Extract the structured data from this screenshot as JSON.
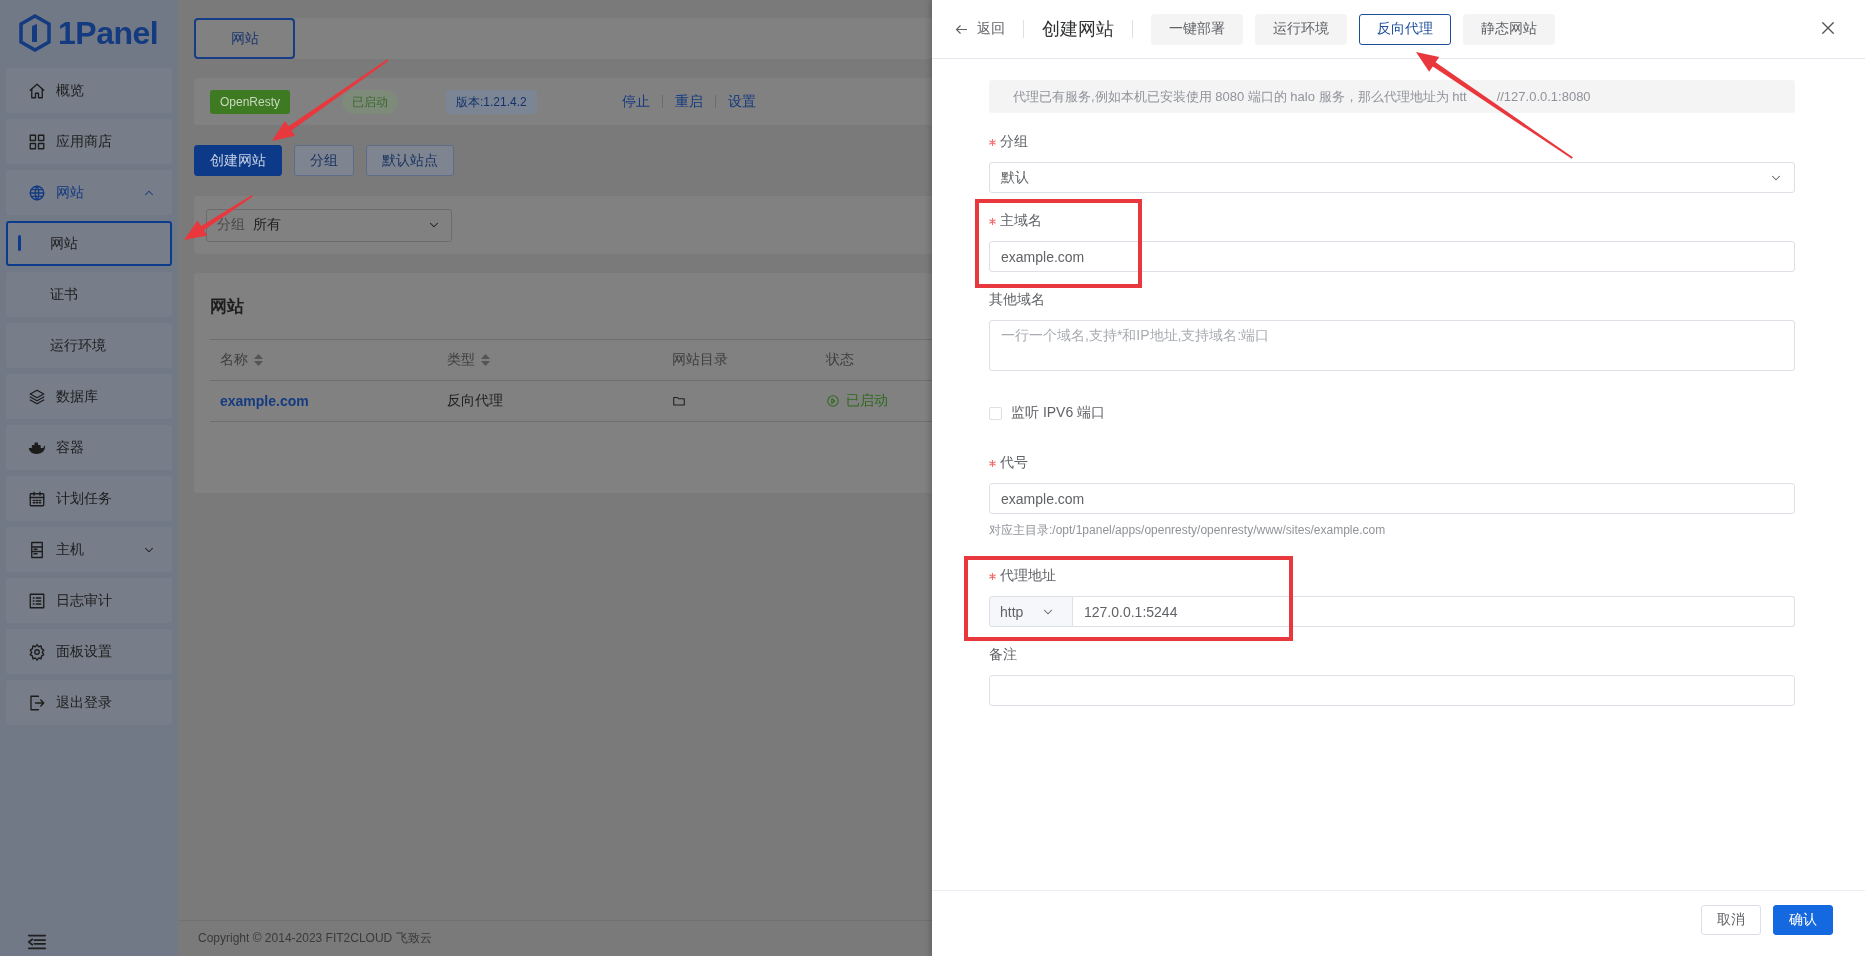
{
  "sidebar": {
    "logo": "1Panel",
    "items": [
      {
        "label": "概览",
        "kind": "link",
        "selected": false
      },
      {
        "label": "应用商店",
        "kind": "link",
        "selected": false
      },
      {
        "label": "网站",
        "kind": "group",
        "expanded": true,
        "selected": false,
        "children": [
          {
            "label": "网站",
            "selected": true
          },
          {
            "label": "证书",
            "selected": false
          },
          {
            "label": "运行环境",
            "selected": false
          }
        ]
      },
      {
        "label": "数据库",
        "kind": "link",
        "selected": false
      },
      {
        "label": "容器",
        "kind": "link",
        "selected": false
      },
      {
        "label": "计划任务",
        "kind": "link",
        "selected": false
      },
      {
        "label": "主机",
        "kind": "group",
        "expanded": false,
        "selected": false
      },
      {
        "label": "日志审计",
        "kind": "link",
        "selected": false
      },
      {
        "label": "面板设置",
        "kind": "link",
        "selected": false
      },
      {
        "label": "退出登录",
        "kind": "link",
        "selected": false
      }
    ]
  },
  "main": {
    "top_tabs": [
      {
        "label": "网站",
        "selected": true
      }
    ],
    "app_status": {
      "name": "OpenResty",
      "status": "已启动",
      "version": "版本:1.21.4.2",
      "actions": [
        "停止",
        "重启",
        "设置"
      ]
    },
    "buttons": [
      {
        "label": "创建网站",
        "kind": "primary"
      },
      {
        "label": "分组",
        "kind": "plain"
      },
      {
        "label": "默认站点",
        "kind": "plain"
      }
    ],
    "filter": {
      "label": "分组",
      "value": "所有"
    },
    "table": {
      "title": "网站",
      "columns": [
        {
          "label": "名称",
          "sortable": true
        },
        {
          "label": "类型",
          "sortable": true
        },
        {
          "label": "网站目录",
          "sortable": false
        },
        {
          "label": "状态",
          "sortable": false
        }
      ],
      "rows": [
        {
          "name": "example.com",
          "type": "反向代理",
          "status": "已启动"
        }
      ]
    },
    "footer": "Copyright © 2014-2023 FIT2CLOUD 飞致云"
  },
  "drawer": {
    "back": "返回",
    "title": "创建网站",
    "tabs": [
      {
        "label": "一键部署",
        "selected": false
      },
      {
        "label": "运行环境",
        "selected": false
      },
      {
        "label": "反向代理",
        "selected": true
      },
      {
        "label": "静态网站",
        "selected": false
      }
    ],
    "alert": [
      "代理已有服务,例如本机已安装使用 8080 端口的 halo 服务，那么代理地址为 htt",
      "//127.0.0.1:8080"
    ],
    "fields": [
      {
        "kind": "select",
        "label": "分组",
        "required": true,
        "value": "默认"
      },
      {
        "kind": "input",
        "label": "主域名",
        "required": true,
        "value": "example.com"
      },
      {
        "kind": "textarea",
        "label": "其他域名",
        "required": false,
        "placeholder": "一行一个域名,支持*和IP地址,支持域名:端口"
      },
      {
        "kind": "checkbox",
        "label": "监听 IPV6 端口",
        "checked": false
      },
      {
        "kind": "input",
        "label": "代号",
        "required": true,
        "value": "example.com",
        "hint": "对应主目录:/opt/1panel/apps/openresty/openresty/www/sites/example.com"
      },
      {
        "kind": "addon",
        "label": "代理地址",
        "required": true,
        "scheme": "http",
        "value": "127.0.0.1:5244"
      },
      {
        "kind": "input",
        "label": "备注",
        "required": false
      }
    ],
    "buttons": [
      {
        "label": "取消",
        "kind": "plain"
      },
      {
        "label": "确认",
        "kind": "primary"
      }
    ]
  }
}
